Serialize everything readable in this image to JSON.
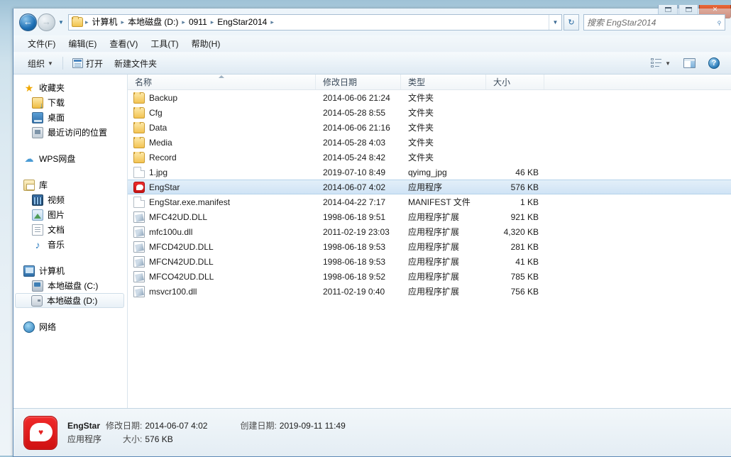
{
  "window": {
    "controls": {
      "minimize": "—",
      "maximize": "□",
      "close": "✕"
    }
  },
  "address": {
    "back_tooltip": "后退",
    "forward_tooltip": "前进",
    "breadcrumbs": [
      "计算机",
      "本地磁盘 (D:)",
      "0911",
      "EngStar2014"
    ],
    "separator": "▸",
    "dropdown": "▼",
    "refresh": "↻"
  },
  "search": {
    "placeholder": "搜索 EngStar2014",
    "icon": "search-icon"
  },
  "menu": {
    "items": [
      {
        "label": "文件(F)"
      },
      {
        "label": "编辑(E)"
      },
      {
        "label": "查看(V)"
      },
      {
        "label": "工具(T)"
      },
      {
        "label": "帮助(H)"
      }
    ]
  },
  "toolbar": {
    "organize_label": "组织",
    "organize_caret": "▼",
    "open_label": "打开",
    "new_folder_label": "新建文件夹",
    "view_caret": "▼",
    "help_glyph": "?"
  },
  "sidebar": {
    "groups": [
      {
        "header": {
          "label": "收藏夹",
          "icon": "star-icon",
          "icon_class": "ic-star",
          "glyph": "★"
        },
        "items": [
          {
            "label": "下载",
            "icon": "download-icon",
            "icon_class": "ic-download"
          },
          {
            "label": "桌面",
            "icon": "desktop-icon",
            "icon_class": "ic-desktop"
          },
          {
            "label": "最近访问的位置",
            "icon": "recent-places-icon",
            "icon_class": "ic-recent"
          }
        ]
      },
      {
        "header": {
          "label": "WPS网盘",
          "icon": "cloud-icon",
          "icon_class": "ic-cloud",
          "glyph": "☁"
        },
        "items": []
      },
      {
        "header": {
          "label": "库",
          "icon": "library-icon",
          "icon_class": "ic-lib"
        },
        "items": [
          {
            "label": "视频",
            "icon": "video-icon",
            "icon_class": "ic-video"
          },
          {
            "label": "图片",
            "icon": "pictures-icon",
            "icon_class": "ic-pic"
          },
          {
            "label": "文档",
            "icon": "documents-icon",
            "icon_class": "ic-doc"
          },
          {
            "label": "音乐",
            "icon": "music-icon",
            "icon_class": "ic-music",
            "glyph": "♪"
          }
        ]
      },
      {
        "header": {
          "label": "计算机",
          "icon": "computer-icon",
          "icon_class": "ic-computer"
        },
        "items": [
          {
            "label": "本地磁盘 (C:)",
            "icon": "disk-c-icon",
            "icon_class": "ic-diskc",
            "selected": false
          },
          {
            "label": "本地磁盘 (D:)",
            "icon": "disk-d-icon",
            "icon_class": "ic-diskd",
            "selected": true
          }
        ]
      },
      {
        "header": {
          "label": "网络",
          "icon": "network-icon",
          "icon_class": "ic-network"
        },
        "items": []
      }
    ]
  },
  "filelist": {
    "columns": [
      {
        "label": "名称",
        "key": "name",
        "sorted": true,
        "sort_dir": "asc"
      },
      {
        "label": "修改日期",
        "key": "date"
      },
      {
        "label": "类型",
        "key": "type"
      },
      {
        "label": "大小",
        "key": "size"
      }
    ],
    "rows": [
      {
        "name": "Backup",
        "date": "2014-06-06 21:24",
        "type": "文件夹",
        "size": "",
        "icon": "folder-icon",
        "icon_class": "folder",
        "selected": false
      },
      {
        "name": "Cfg",
        "date": "2014-05-28 8:55",
        "type": "文件夹",
        "size": "",
        "icon": "folder-icon",
        "icon_class": "folder",
        "selected": false
      },
      {
        "name": "Data",
        "date": "2014-06-06 21:16",
        "type": "文件夹",
        "size": "",
        "icon": "folder-icon",
        "icon_class": "folder",
        "selected": false
      },
      {
        "name": "Media",
        "date": "2014-05-28 4:03",
        "type": "文件夹",
        "size": "",
        "icon": "folder-icon",
        "icon_class": "folder",
        "selected": false
      },
      {
        "name": "Record",
        "date": "2014-05-24 8:42",
        "type": "文件夹",
        "size": "",
        "icon": "folder-icon",
        "icon_class": "folder",
        "selected": false
      },
      {
        "name": "1.jpg",
        "date": "2019-07-10 8:49",
        "type": "qyimg_jpg",
        "size": "46 KB",
        "icon": "file-icon",
        "icon_class": "blank",
        "selected": false
      },
      {
        "name": "EngStar",
        "date": "2014-06-07 4:02",
        "type": "应用程序",
        "size": "576 KB",
        "icon": "app-icon",
        "icon_class": "app",
        "selected": true
      },
      {
        "name": "EngStar.exe.manifest",
        "date": "2014-04-22 7:17",
        "type": "MANIFEST 文件",
        "size": "1 KB",
        "icon": "file-icon",
        "icon_class": "blank",
        "selected": false
      },
      {
        "name": "MFC42UD.DLL",
        "date": "1998-06-18 9:51",
        "type": "应用程序扩展",
        "size": "921 KB",
        "icon": "dll-icon",
        "icon_class": "dll",
        "selected": false
      },
      {
        "name": "mfc100u.dll",
        "date": "2011-02-19 23:03",
        "type": "应用程序扩展",
        "size": "4,320 KB",
        "icon": "dll-icon",
        "icon_class": "dll",
        "selected": false
      },
      {
        "name": "MFCD42UD.DLL",
        "date": "1998-06-18 9:53",
        "type": "应用程序扩展",
        "size": "281 KB",
        "icon": "dll-icon",
        "icon_class": "dll",
        "selected": false
      },
      {
        "name": "MFCN42UD.DLL",
        "date": "1998-06-18 9:53",
        "type": "应用程序扩展",
        "size": "41 KB",
        "icon": "dll-icon",
        "icon_class": "dll",
        "selected": false
      },
      {
        "name": "MFCO42UD.DLL",
        "date": "1998-06-18 9:52",
        "type": "应用程序扩展",
        "size": "785 KB",
        "icon": "dll-icon",
        "icon_class": "dll",
        "selected": false
      },
      {
        "name": "msvcr100.dll",
        "date": "2011-02-19 0:40",
        "type": "应用程序扩展",
        "size": "756 KB",
        "icon": "dll-icon",
        "icon_class": "dll",
        "selected": false
      }
    ]
  },
  "details": {
    "icon": "engstar-app-icon",
    "name": "EngStar",
    "modified_label": "修改日期:",
    "modified_value": "2014-06-07 4:02",
    "created_label": "创建日期:",
    "created_value": "2019-09-11 11:49",
    "type": "应用程序",
    "size_label": "大小:",
    "size_value": "576 KB"
  },
  "colors": {
    "selection": "#cfe3f5",
    "accent": "#2a7ab8",
    "app_red": "#d81616",
    "folder_yellow": "#f3c352"
  }
}
